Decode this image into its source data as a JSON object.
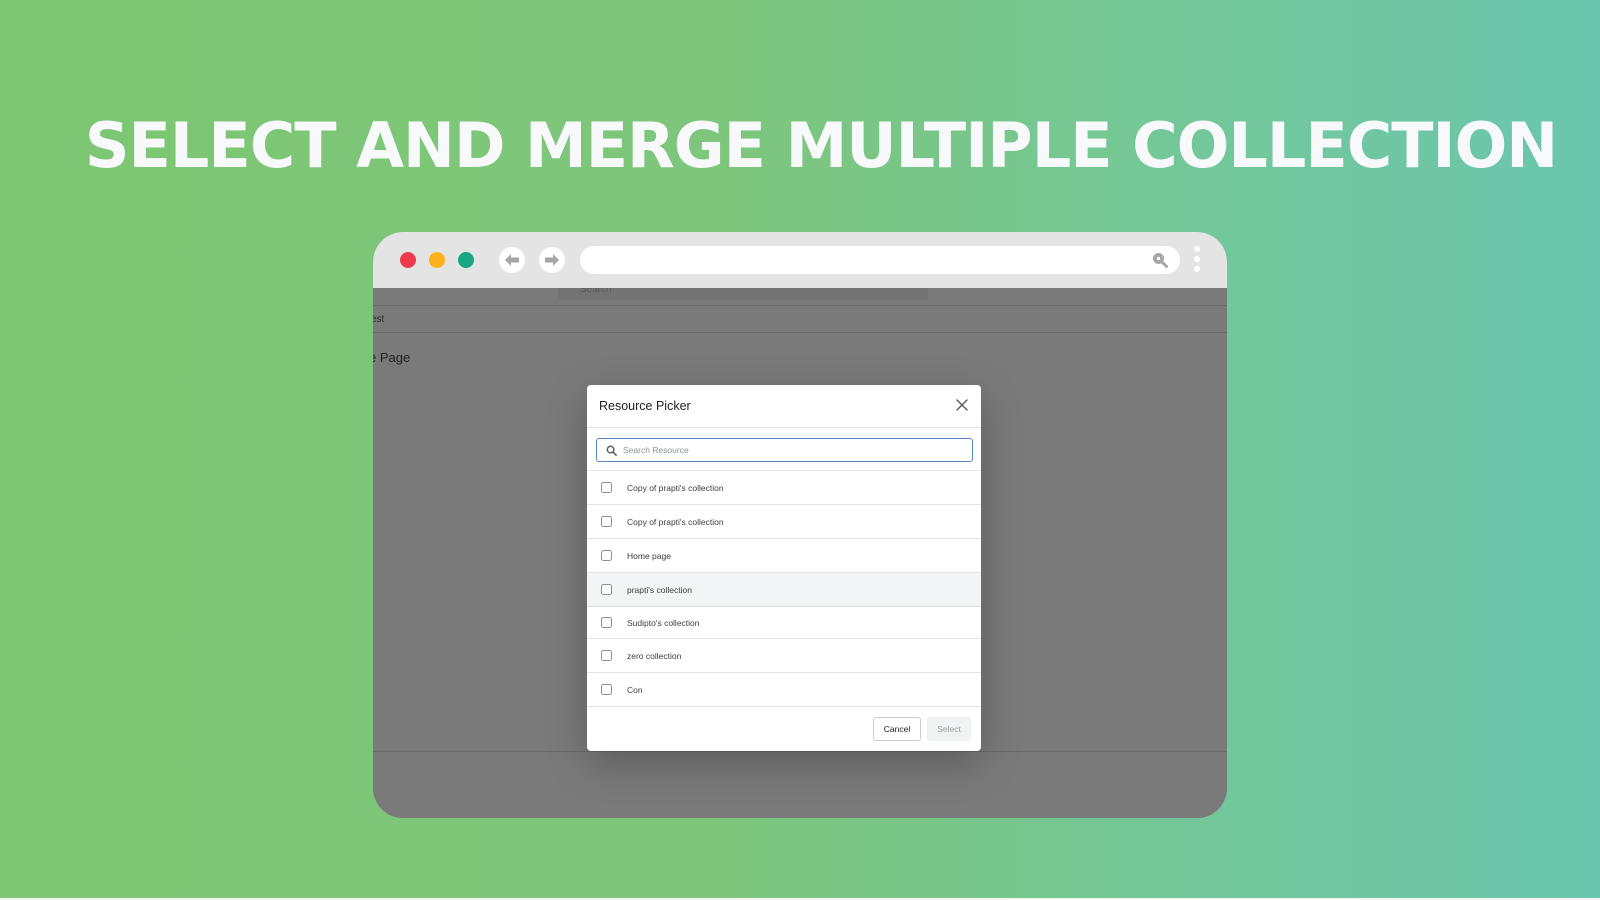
{
  "hero": {
    "title": "SELECT AND MERGE MULTIPLE COLLECTION"
  },
  "browser": {
    "traffic_lights": {
      "close_color": "#ee3a4a",
      "minimize_color": "#fdb21b",
      "maximize_color": "#17a881"
    },
    "back_icon": "arrow-left-icon",
    "forward_icon": "arrow-right-icon",
    "url": "",
    "url_search_icon": "search-icon",
    "menu_icon": "kebab-menu-icon"
  },
  "background_page": {
    "search_placeholder": "Search",
    "breadcrumb": "est",
    "title": "e Page"
  },
  "modal": {
    "title": "Resource Picker",
    "close_icon": "close-icon",
    "search": {
      "placeholder": "Search Resource",
      "value": ""
    },
    "items": [
      {
        "label": "Copy of prapti's collection",
        "checked": false
      },
      {
        "label": "Copy of prapti's collection",
        "checked": false
      },
      {
        "label": "Home page",
        "checked": false
      },
      {
        "label": "prapti's collection",
        "checked": false,
        "hovered": true
      },
      {
        "label": "Sudipto's collection",
        "checked": false
      },
      {
        "label": "zero collection",
        "checked": false
      },
      {
        "label": "Con",
        "checked": false
      }
    ],
    "footer": {
      "cancel_label": "Cancel",
      "select_label": "Select",
      "select_disabled": true
    }
  },
  "colors": {
    "accent_focus": "#5b86c8",
    "title_text": "#f8f9fb",
    "gradient_start": "#7dc672",
    "gradient_end": "#6bc6ae"
  }
}
